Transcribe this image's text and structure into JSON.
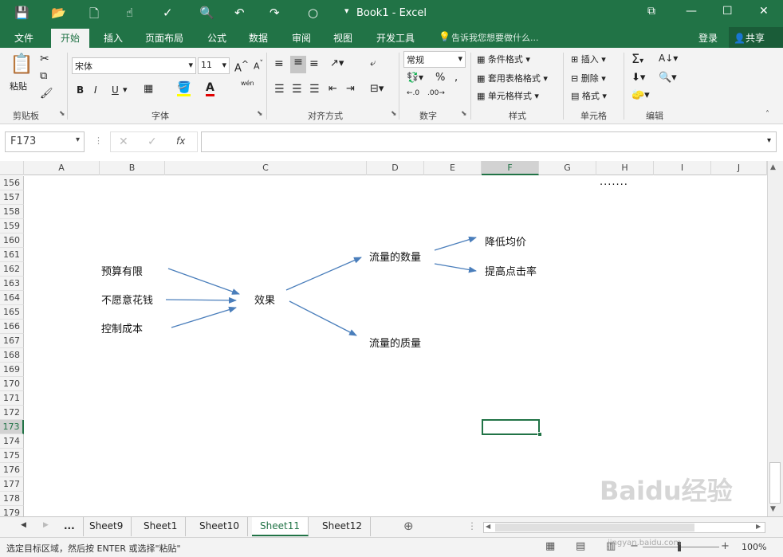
{
  "app": {
    "window_title": "Book1 - Excel"
  },
  "tabs": {
    "file": "文件",
    "home": "开始",
    "insert": "插入",
    "page_layout": "页面布局",
    "formulas": "公式",
    "data": "数据",
    "review": "审阅",
    "view": "视图",
    "developer": "开发工具",
    "tell_me": "告诉我您想要做什么...",
    "login": "登录",
    "share": "共享"
  },
  "ribbon": {
    "paste": "粘贴",
    "clipboard": "剪贴板",
    "font_name": "宋体",
    "font_size": "11",
    "font_group": "字体",
    "bold": "B",
    "italic": "I",
    "underline": "U",
    "align_group": "对齐方式",
    "number_format": "常规",
    "number_group": "数字",
    "cond_format": "条件格式",
    "table_format": "套用表格格式",
    "cell_style": "单元格样式",
    "styles_group": "样式",
    "insert_cells": "插入",
    "delete_cells": "删除",
    "format_cells": "格式",
    "cells_group": "单元格",
    "editing_group": "编辑",
    "phonetic": "wén"
  },
  "formula_bar": {
    "name_box": "F173",
    "fx": "fx",
    "formula": ""
  },
  "columns": [
    "A",
    "B",
    "C",
    "D",
    "E",
    "F",
    "G",
    "H",
    "I",
    "J"
  ],
  "rows": [
    "156",
    "157",
    "158",
    "159",
    "160",
    "161",
    "162",
    "163",
    "164",
    "165",
    "166",
    "167",
    "168",
    "169",
    "170",
    "171",
    "172",
    "173",
    "174",
    "175",
    "176",
    "177",
    "178",
    "179"
  ],
  "diagram": {
    "dots": ".......",
    "cause1": "预算有限",
    "cause2": "不愿意花钱",
    "cause3": "控制成本",
    "center": "效果",
    "branch1": "流量的数量",
    "branch2": "流量的质量",
    "leaf1": "降低均价",
    "leaf2": "提高点击率"
  },
  "sheets": {
    "more": "...",
    "list": [
      "Sheet9",
      "Sheet1",
      "Sheet10",
      "Sheet11",
      "Sheet12"
    ],
    "active": "Sheet11"
  },
  "status": {
    "message": "选定目标区域，然后按 ENTER 或选择\"粘贴\"",
    "zoom": "100%"
  },
  "watermark": {
    "text": "Baidu经验",
    "sub": "jingyan.baidu.com"
  },
  "colors": {
    "excel_green": "#217346",
    "arrow": "#4a7ebb",
    "ribbon_bg": "#f3f3f3"
  }
}
